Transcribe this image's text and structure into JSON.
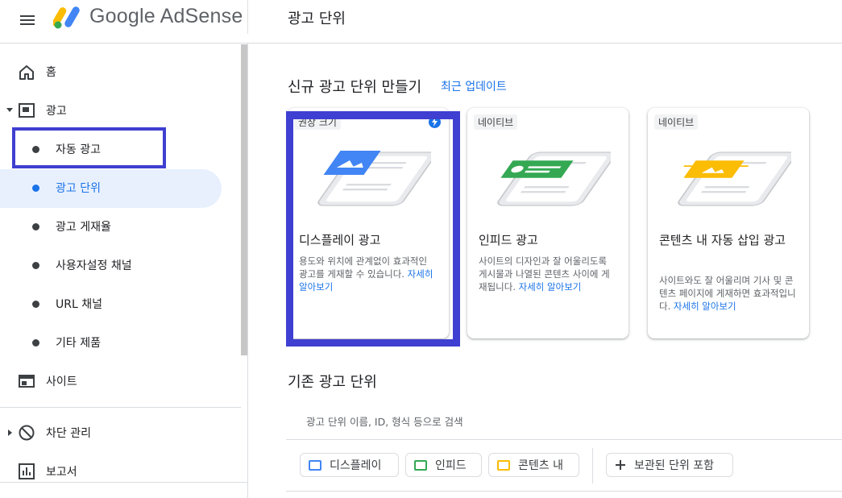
{
  "header": {
    "brand": "Google AdSense",
    "page_title": "광고 단위"
  },
  "sidebar": {
    "home": "홈",
    "ads": "광고",
    "sub_items": [
      "자동 광고",
      "광고 단위",
      "광고 게재율",
      "사용자설정 채널",
      "URL 채널",
      "기타 제품"
    ],
    "sites": "사이트",
    "blocking": "차단 관리",
    "reports": "보고서"
  },
  "main": {
    "new_section_title": "신규 광고 단위 만들기",
    "recent_updates_link": "최근 업데이트",
    "cards": [
      {
        "chip": "권장 크기",
        "title": "디스플레이 광고",
        "desc": "용도와 위치에 관계없이 효과적인 광고를 게재할 수 있습니다.",
        "link": "자세히 알아보기"
      },
      {
        "chip": "네이티브",
        "title": "인피드 광고",
        "desc": "사이트의 디자인과 잘 어울리도록 게시물과 나열된 콘텐츠 사이에 게재됩니다.",
        "link": "자세히 알아보기"
      },
      {
        "chip": "네이티브",
        "title": "콘텐츠 내 자동 삽입 광고",
        "desc": "사이트와도 잘 어울리며 기사 및 콘텐츠 페이지에 게재하면 효과적입니다.",
        "link": "자세히 알아보기"
      }
    ],
    "existing_section_title": "기존 광고 단위",
    "search_placeholder": "광고 단위 이름, ID, 형식 등으로 검색",
    "filters": [
      "디스플레이",
      "인피드",
      "콘텐츠 내"
    ],
    "include_archived": "보관된 단위 포함"
  },
  "colors": {
    "accent_blue": "#1a73e8",
    "display_blue": "#4285f4",
    "infeed_green": "#34a853",
    "incontent_yellow": "#fbbc04",
    "highlight_frame": "#3f3fd1"
  }
}
